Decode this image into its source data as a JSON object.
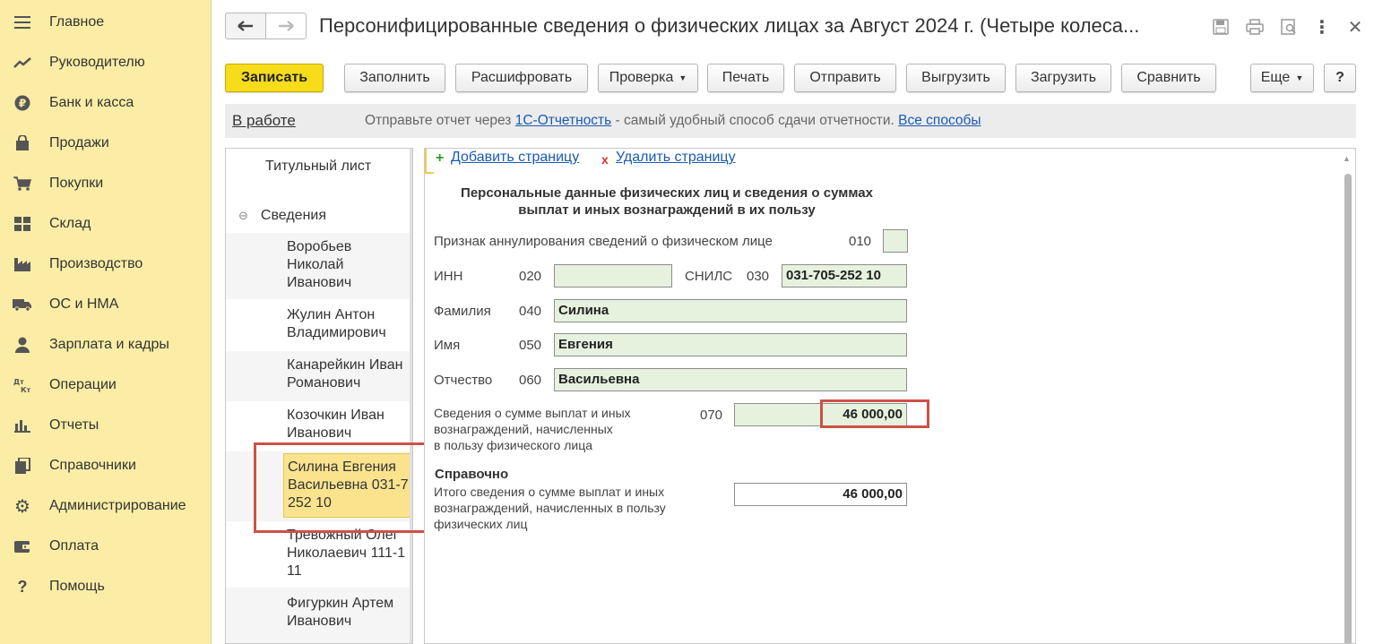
{
  "sidebar": {
    "items": [
      {
        "label": "Главное",
        "icon": "menu-icon"
      },
      {
        "label": "Руководителю",
        "icon": "trend-icon"
      },
      {
        "label": "Банк и касса",
        "icon": "ruble-icon"
      },
      {
        "label": "Продажи",
        "icon": "bag-icon"
      },
      {
        "label": "Покупки",
        "icon": "cart-icon"
      },
      {
        "label": "Склад",
        "icon": "warehouse-icon"
      },
      {
        "label": "Производство",
        "icon": "factory-icon"
      },
      {
        "label": "ОС и НМА",
        "icon": "truck-icon"
      },
      {
        "label": "Зарплата и кадры",
        "icon": "person-icon"
      },
      {
        "label": "Операции",
        "icon": "dt-kt-icon"
      },
      {
        "label": "Отчеты",
        "icon": "bar-chart-icon"
      },
      {
        "label": "Справочники",
        "icon": "books-icon"
      },
      {
        "label": "Администрирование",
        "icon": "gear-icon"
      },
      {
        "label": "Оплата",
        "icon": "wallet-icon"
      },
      {
        "label": "Помощь",
        "icon": "question-icon"
      }
    ]
  },
  "header": {
    "title": "Персонифицированные сведения о физических лицах за Август 2024 г. (Четыре колеса..."
  },
  "toolbar": {
    "save": "Записать",
    "fill": "Заполнить",
    "decode": "Расшифровать",
    "check": "Проверка",
    "print": "Печать",
    "send": "Отправить",
    "export": "Выгрузить",
    "import": "Загрузить",
    "compare": "Сравнить",
    "more": "Еще",
    "help": "?"
  },
  "infobar": {
    "status": "В работе",
    "text_before": "Отправьте отчет через ",
    "link_1c": "1С-Отчетность",
    "text_after": " - самый удобный способ сдачи отчетности. ",
    "link_all": "Все способы"
  },
  "tree": {
    "title_page": "Титульный лист",
    "section_toggle": "⊖",
    "section": "Сведения",
    "people": [
      [
        "Воробьев",
        "Николай",
        "Иванович"
      ],
      [
        "Жулин Антон",
        "Владимирович"
      ],
      [
        "Канарейкин Иван",
        "Романович"
      ],
      [
        "Козочкин Иван",
        "Иванович"
      ],
      [
        "Силина Евгения",
        "Васильевна 031-7",
        "252 10"
      ],
      [
        "Тревожный Олег",
        "Николаевич 111-1",
        "11"
      ],
      [
        "Фигуркин Артем",
        "Иванович"
      ]
    ]
  },
  "form": {
    "add_page": "Добавить страницу",
    "delete_page": "Удалить страницу",
    "heading_line1": "Персональные данные физических лиц и сведения о суммах",
    "heading_line2": "выплат и иных вознаграждений в их пользу",
    "cancel_label": "Признак аннулирования сведений о физическом лице",
    "cancel_code": "010",
    "inn_label": "ИНН",
    "inn_code": "020",
    "inn_value": "",
    "snils_label": "СНИЛС",
    "snils_code": "030",
    "snils_value": "031-705-252 10",
    "surname_label": "Фамилия",
    "surname_code": "040",
    "surname_value": "Силина",
    "name_label": "Имя",
    "name_code": "050",
    "name_value": "Евгения",
    "patronymic_label": "Отчество",
    "patronymic_code": "060",
    "patronymic_value": "Васильевна",
    "payments_label_1": "Сведения о сумме выплат и иных",
    "payments_label_2": "вознаграждений, начисленных",
    "payments_label_3": "в пользу физического лица",
    "payments_code": "070",
    "payments_value": "46 000,00",
    "ref_title": "Справочно",
    "total_label_1": "Итого сведения о сумме выплат и иных",
    "total_label_2": "вознаграждений, начисленных в пользу",
    "total_label_3": "физических лиц",
    "total_value": "46 000,00"
  },
  "colors": {
    "sidebar_bg": "#fbeda6",
    "primary_button": "#f7dc1b",
    "field_bg": "#e6f1de",
    "highlight": "#cc5246",
    "link": "#1a5bb2"
  }
}
